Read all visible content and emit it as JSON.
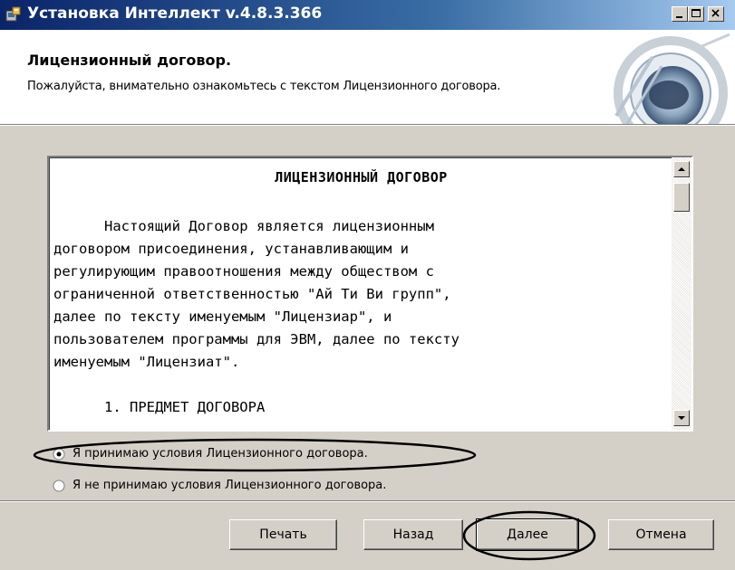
{
  "window": {
    "title": "Установка Интеллект v.4.8.3.366"
  },
  "header": {
    "title": "Лицензионный договор.",
    "subtitle": "Пожалуйста, внимательно ознакомьтесь с текстом Лицензионного договора."
  },
  "license": {
    "heading": "ЛИЦЕНЗИОННЫЙ ДОГОВОР",
    "lines": [
      "      Настоящий Договор является лицензионным",
      "договором присоединения, устанавливающим и",
      "регулирующим правоотношения между обществом с",
      "ограниченной ответственностью \"Ай Ти Ви групп\",",
      "далее по тексту именуемым \"Лицензиар\", и",
      "пользователем программы для ЭВМ, далее по тексту",
      "именуемым \"Лицензиат\".",
      "",
      "      1. ПРЕДМЕТ ДОГОВОРА"
    ]
  },
  "options": {
    "accept_label": "Я принимаю условия Лицензионного договора.",
    "decline_label": "Я не принимаю условия Лицензионного договора.",
    "selected": "accept"
  },
  "buttons": {
    "print": "Печать",
    "back": "Назад",
    "next": "Далее",
    "cancel": "Отмена"
  },
  "colors": {
    "titlebar_start": "#0a246a",
    "titlebar_end": "#a6caf0",
    "face": "#d4d0c8",
    "annotation": "#000000"
  },
  "icons": [
    "installer-icon",
    "minimize-icon",
    "maximize-icon",
    "close-icon",
    "scroll-up-arrow-icon",
    "scroll-down-arrow-icon"
  ]
}
